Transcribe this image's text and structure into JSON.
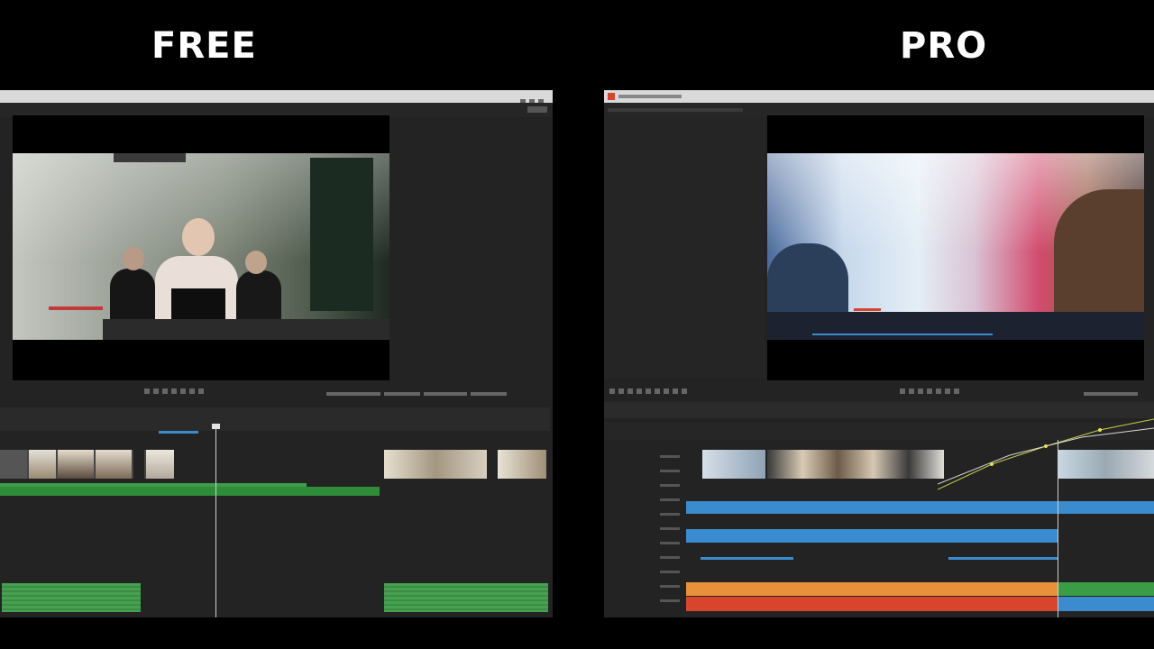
{
  "left_heading": "FREE",
  "right_heading": "PRO",
  "colors": {
    "accent_green": "#3a9d45",
    "accent_blue": "#3a8ccf",
    "accent_orange": "#e8913a",
    "accent_red": "#d8452c",
    "panel_bg": "#232323"
  },
  "free_editor": {
    "timeline_tracks": [
      "video",
      "audio-top",
      "audio-bottom"
    ],
    "icons": [
      "play-controls",
      "timeline-ruler",
      "playhead"
    ]
  },
  "pro_editor": {
    "timeline_tracks": [
      "video",
      "blue-1",
      "blue-2",
      "blue-3",
      "orange",
      "red",
      "green",
      "teal"
    ],
    "icons": [
      "app-logo-icon",
      "play-controls",
      "keyframe-curve"
    ]
  }
}
